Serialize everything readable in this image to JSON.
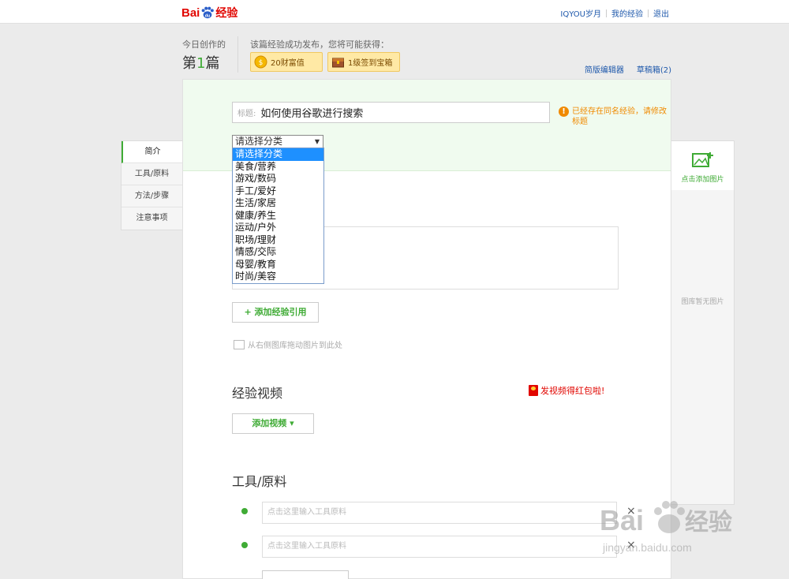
{
  "header": {
    "logo_text": "Bai",
    "logo_suffix": "经验",
    "user_name": "IQYOU岁月",
    "my_experience": "我的经验",
    "logout": "退出"
  },
  "status": {
    "today_label": "今日创作的",
    "count_prefix": "第",
    "count_num": "1",
    "count_suffix": "篇",
    "reward_label": "该篇经验成功发布，您将可能获得：",
    "reward_wealth": "20财富值",
    "reward_box": "1级签到宝箱",
    "simple_editor": "简版编辑器",
    "drafts": "草稿箱(2)"
  },
  "side_tabs": [
    {
      "label": "简介",
      "active": true
    },
    {
      "label": "工具/原料",
      "active": false
    },
    {
      "label": "方法/步骤",
      "active": false
    },
    {
      "label": "注意事项",
      "active": false
    }
  ],
  "form": {
    "title_label": "标题:",
    "title_value": "如何使用谷歌进行搜索",
    "warning": "已经存在同名经验，请修改标题",
    "category_selected": "请选择分类",
    "category_options": [
      "请选择分类",
      "美食/营养",
      "游戏/数码",
      "手工/爱好",
      "生活/家居",
      "健康/养生",
      "运动/户外",
      "职场/理财",
      "情感/交际",
      "母婴/教育",
      "时尚/美容"
    ],
    "add_ref_button": "+ 添加经验引用",
    "drag_hint": "从右侧图库拖动图片到此处"
  },
  "video": {
    "title": "经验视频",
    "promo": "发视频得红包啦!",
    "add_button": "添加视频 ▾"
  },
  "tools": {
    "title": "工具/原料",
    "placeholder1": "点击这里输入工具原料",
    "placeholder2": "点击这里输入工具原料",
    "remove": "×"
  },
  "gallery": {
    "add_label": "点击添加图片",
    "empty": "图库暂无图片"
  },
  "watermark": {
    "url": "jingyan.baidu.com"
  },
  "colors": {
    "brand_red": "#e10601",
    "accent_green": "#3fab35",
    "link_blue": "#1e58ab",
    "warning_orange": "#f08a00"
  }
}
